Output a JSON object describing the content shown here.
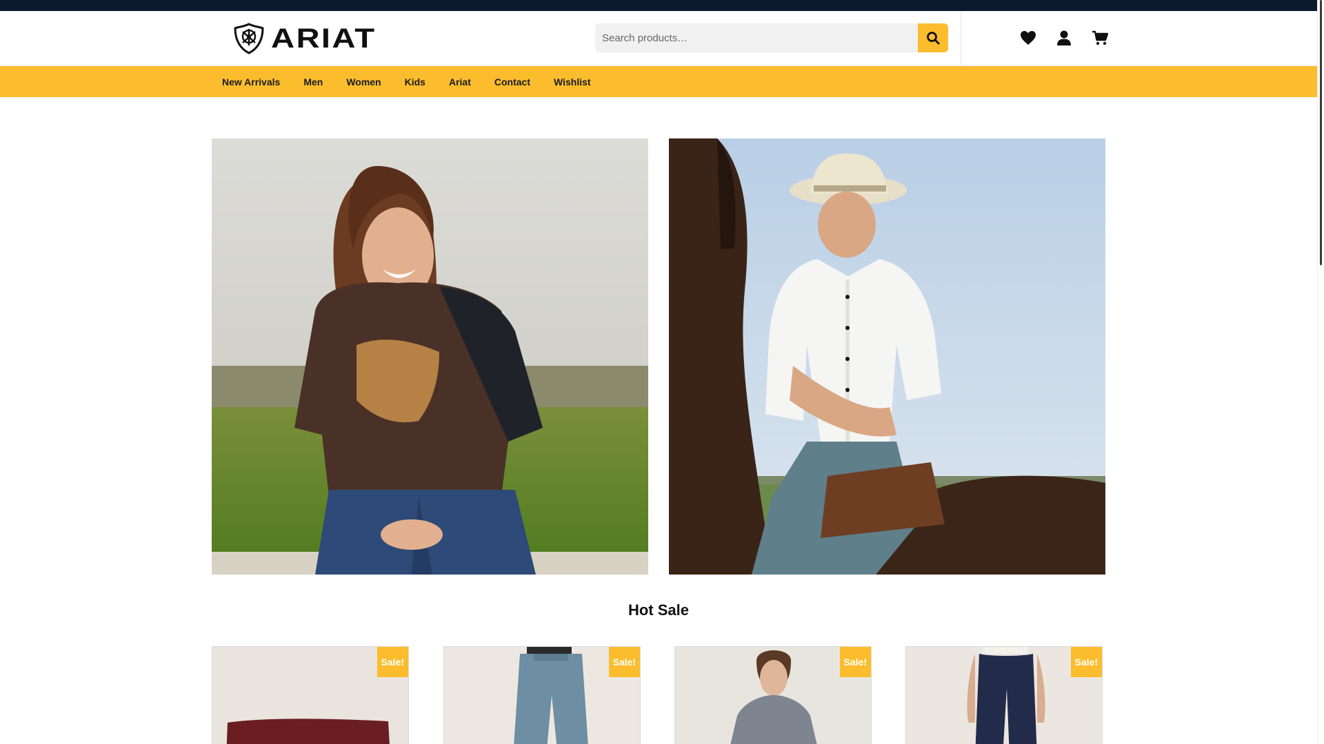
{
  "brand": {
    "name": "ARIAT"
  },
  "search": {
    "placeholder": "Search products…"
  },
  "header_icons": [
    {
      "name": "wishlist",
      "icon": "heart-icon"
    },
    {
      "name": "account",
      "icon": "user-icon"
    },
    {
      "name": "cart",
      "icon": "cart-icon"
    }
  ],
  "nav": {
    "items": [
      {
        "label": "New Arrivals"
      },
      {
        "label": "Men"
      },
      {
        "label": "Women"
      },
      {
        "label": "Kids"
      },
      {
        "label": "Ariat"
      },
      {
        "label": "Contact"
      },
      {
        "label": "Wishlist"
      }
    ]
  },
  "hot_sale": {
    "title": "Hot Sale",
    "products": [
      {
        "badge": "Sale!"
      },
      {
        "badge": "Sale!"
      },
      {
        "badge": "Sale!"
      },
      {
        "badge": "Sale!"
      }
    ]
  },
  "colors": {
    "accent": "#fbbd2d",
    "top_strip": "#0b1a2c"
  }
}
